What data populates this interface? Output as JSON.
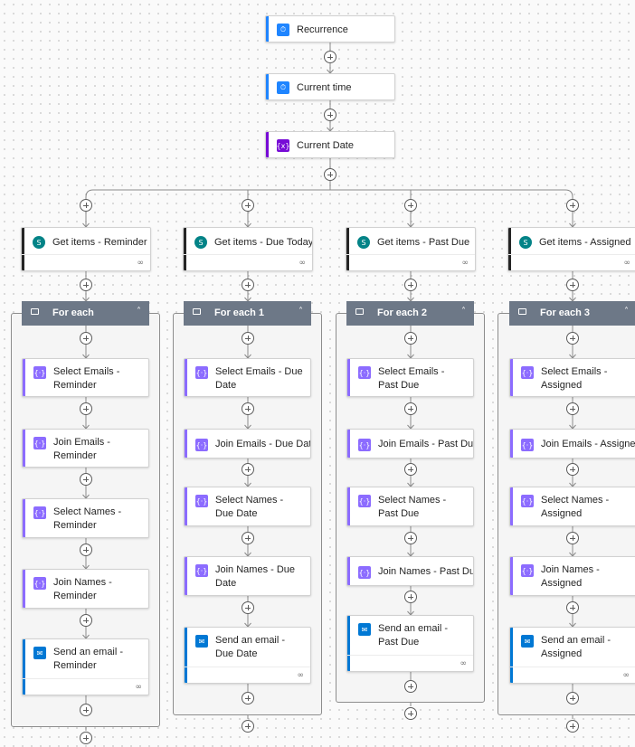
{
  "flow": {
    "colors": {
      "schedule": "#1f85ff",
      "variable": "#770bd6",
      "sharepoint": "#038387",
      "data_op": "#8c6cff",
      "outlook": "#0078d4",
      "scope_header": "#6d7887",
      "connector": "#8a8a8a"
    },
    "top_steps": [
      {
        "label": "Recurrence",
        "icon": "clock-icon"
      },
      {
        "label": "Current time",
        "icon": "clock-icon"
      },
      {
        "label": "Current Date",
        "icon": "variable-icon"
      }
    ],
    "branches": [
      {
        "get_items": {
          "label": "Get items - Reminder",
          "icon": "sharepoint-icon",
          "footer_icon": "link-icon"
        },
        "loop": {
          "label": "For each",
          "collapse_icon": "chevron-up-icon"
        },
        "steps": [
          {
            "label": "Select Emails - Reminder",
            "icon": "data-operation-icon"
          },
          {
            "label": "Join Emails - Reminder",
            "icon": "data-operation-icon"
          },
          {
            "label": "Select Names - Reminder",
            "icon": "data-operation-icon"
          },
          {
            "label": "Join Names - Reminder",
            "icon": "data-operation-icon"
          },
          {
            "label": "Send an email - Reminder",
            "icon": "outlook-icon",
            "footer_icon": "link-icon"
          }
        ]
      },
      {
        "get_items": {
          "label": "Get items - Due Today",
          "icon": "sharepoint-icon",
          "footer_icon": "link-icon"
        },
        "loop": {
          "label": "For each 1",
          "collapse_icon": "chevron-up-icon"
        },
        "steps": [
          {
            "label": "Select Emails - Due Date",
            "icon": "data-operation-icon"
          },
          {
            "label": "Join Emails - Due Date",
            "icon": "data-operation-icon"
          },
          {
            "label": "Select Names - Due Date",
            "icon": "data-operation-icon"
          },
          {
            "label": "Join Names - Due Date",
            "icon": "data-operation-icon"
          },
          {
            "label": "Send an email - Due Date",
            "icon": "outlook-icon",
            "footer_icon": "link-icon"
          }
        ]
      },
      {
        "get_items": {
          "label": "Get items - Past Due",
          "icon": "sharepoint-icon",
          "footer_icon": "link-icon"
        },
        "loop": {
          "label": "For each 2",
          "collapse_icon": "chevron-up-icon"
        },
        "steps": [
          {
            "label": "Select Emails - Past Due",
            "icon": "data-operation-icon"
          },
          {
            "label": "Join Emails - Past Due",
            "icon": "data-operation-icon"
          },
          {
            "label": "Select Names - Past Due",
            "icon": "data-operation-icon"
          },
          {
            "label": "Join Names - Past Due",
            "icon": "data-operation-icon"
          },
          {
            "label": "Send an email - Past Due",
            "icon": "outlook-icon",
            "footer_icon": "link-icon"
          }
        ]
      },
      {
        "get_items": {
          "label": "Get items - Assigned",
          "icon": "sharepoint-icon",
          "footer_icon": "link-icon"
        },
        "loop": {
          "label": "For each 3",
          "collapse_icon": "chevron-up-icon"
        },
        "steps": [
          {
            "label": "Select Emails - Assigned",
            "icon": "data-operation-icon"
          },
          {
            "label": "Join Emails - Assigned",
            "icon": "data-operation-icon"
          },
          {
            "label": "Select Names - Assigned",
            "icon": "data-operation-icon"
          },
          {
            "label": "Join Names - Assigned",
            "icon": "data-operation-icon"
          },
          {
            "label": "Send an email - Assigned",
            "icon": "outlook-icon",
            "footer_icon": "link-icon"
          }
        ]
      }
    ]
  }
}
